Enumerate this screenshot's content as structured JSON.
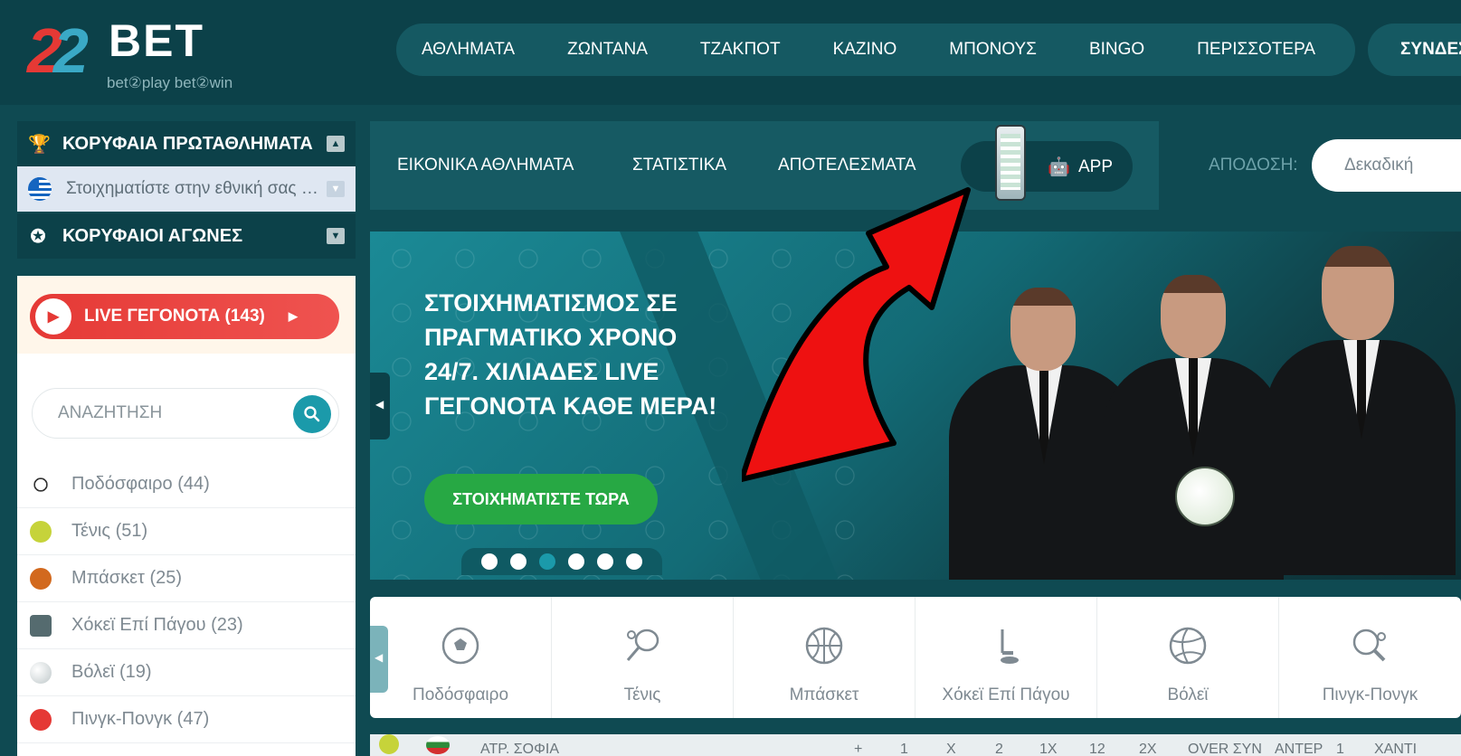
{
  "brand": {
    "logo_number": "22",
    "logo_word": "BET",
    "tagline": "bet②play  bet②win",
    "colors": {
      "primary": "#0c4149",
      "accent": "#1b9aaa",
      "live": "#e53935",
      "cta": "#27a844"
    }
  },
  "header": {
    "nav": [
      "ΑΘΛΗΜΑΤΑ",
      "ΖΩΝΤΑΝΑ",
      "ΤΖΑΚΠΟΤ",
      "ΚΑΖΙΝΟ",
      "ΜΠΟΝΟΥΣ",
      "BINGO",
      "ΠΕΡΙΣΣΟΤΕΡΑ"
    ],
    "login_label": "ΣΥΝΔΕΣΗ"
  },
  "sidebar": {
    "top_leagues_label": "ΚΟΡΥΦΑΙΑ ΠΡΩΤΑΘΛΗΜΑΤΑ",
    "national_bet_label": "Στοιχηματίστε στην εθνική σας ομάδα",
    "top_matches_label": "ΚΟΡΥΦΑΙΟΙ ΑΓΩΝΕΣ",
    "live_label": "LIVE ΓΕΓΟΝΟΤΑ (143)",
    "search_placeholder": "ΑΝΑΖΗΤΗΣΗ",
    "sports": [
      {
        "label": "Ποδόσφαιρο (44)",
        "icon": "football-icon",
        "color": "#333333"
      },
      {
        "label": "Τένις (51)",
        "icon": "tennis-ball-icon",
        "color": "#c6d33a"
      },
      {
        "label": "Μπάσκετ (25)",
        "icon": "basketball-icon",
        "color": "#d2691e"
      },
      {
        "label": "Χόκεϊ Επί Πάγου (23)",
        "icon": "ice-skate-icon",
        "color": "#556b6f"
      },
      {
        "label": "Βόλεϊ (19)",
        "icon": "volleyball-icon",
        "color": "#cfd6d8"
      },
      {
        "label": "Πινγκ-Πονγκ (47)",
        "icon": "ping-pong-icon",
        "color": "#e53935"
      }
    ]
  },
  "subnav": {
    "items": [
      "ΕΙΚΟΝΙΚΑ ΑΘΛΗΜΑΤΑ",
      "ΣΤΑΤΙΣΤΙΚΑ",
      "ΑΠΟΤΕΛΕΣΜΑΤΑ"
    ],
    "app_label": "APP",
    "odds_label": "ΑΠΟΔΟΣΗ:",
    "odds_value": "Δεκαδική"
  },
  "banner": {
    "headline": "ΣΤΟΙΧΗΜΑΤΙΣΜΟΣ ΣΕ ΠΡΑΓΜΑΤΙΚΟ ΧΡΟΝΟ 24/7. ΧΙΛΙΑΔΕΣ LIVE ΓΕΓΟΝΟΤΑ ΚΑΘΕ ΜΕΡΑ!",
    "cta": "ΣΤΟΙΧΗΜΑΤΙΣΤΕ ΤΩΡΑ",
    "slide_count": 6,
    "active_slide": 3
  },
  "sports_bar": [
    {
      "label": "Ποδόσφαιρο",
      "icon": "football-icon"
    },
    {
      "label": "Τένις",
      "icon": "tennis-racket-icon"
    },
    {
      "label": "Μπάσκετ",
      "icon": "basketball-icon"
    },
    {
      "label": "Χόκεϊ Επί Πάγου",
      "icon": "hockey-stick-icon"
    },
    {
      "label": "Βόλεϊ",
      "icon": "volleyball-icon"
    },
    {
      "label": "Πινγκ-Πονγκ",
      "icon": "ping-pong-icon"
    }
  ],
  "match_row": {
    "team": "ΑΤΡ. ΣΟΦΙΑ",
    "columns": [
      "+",
      "1",
      "X",
      "2",
      "1X",
      "12",
      "2X",
      "OVER ΣΥΝ",
      "ΑΝΤΕΡ",
      "1",
      "ΧΑΝΤΙ"
    ]
  }
}
